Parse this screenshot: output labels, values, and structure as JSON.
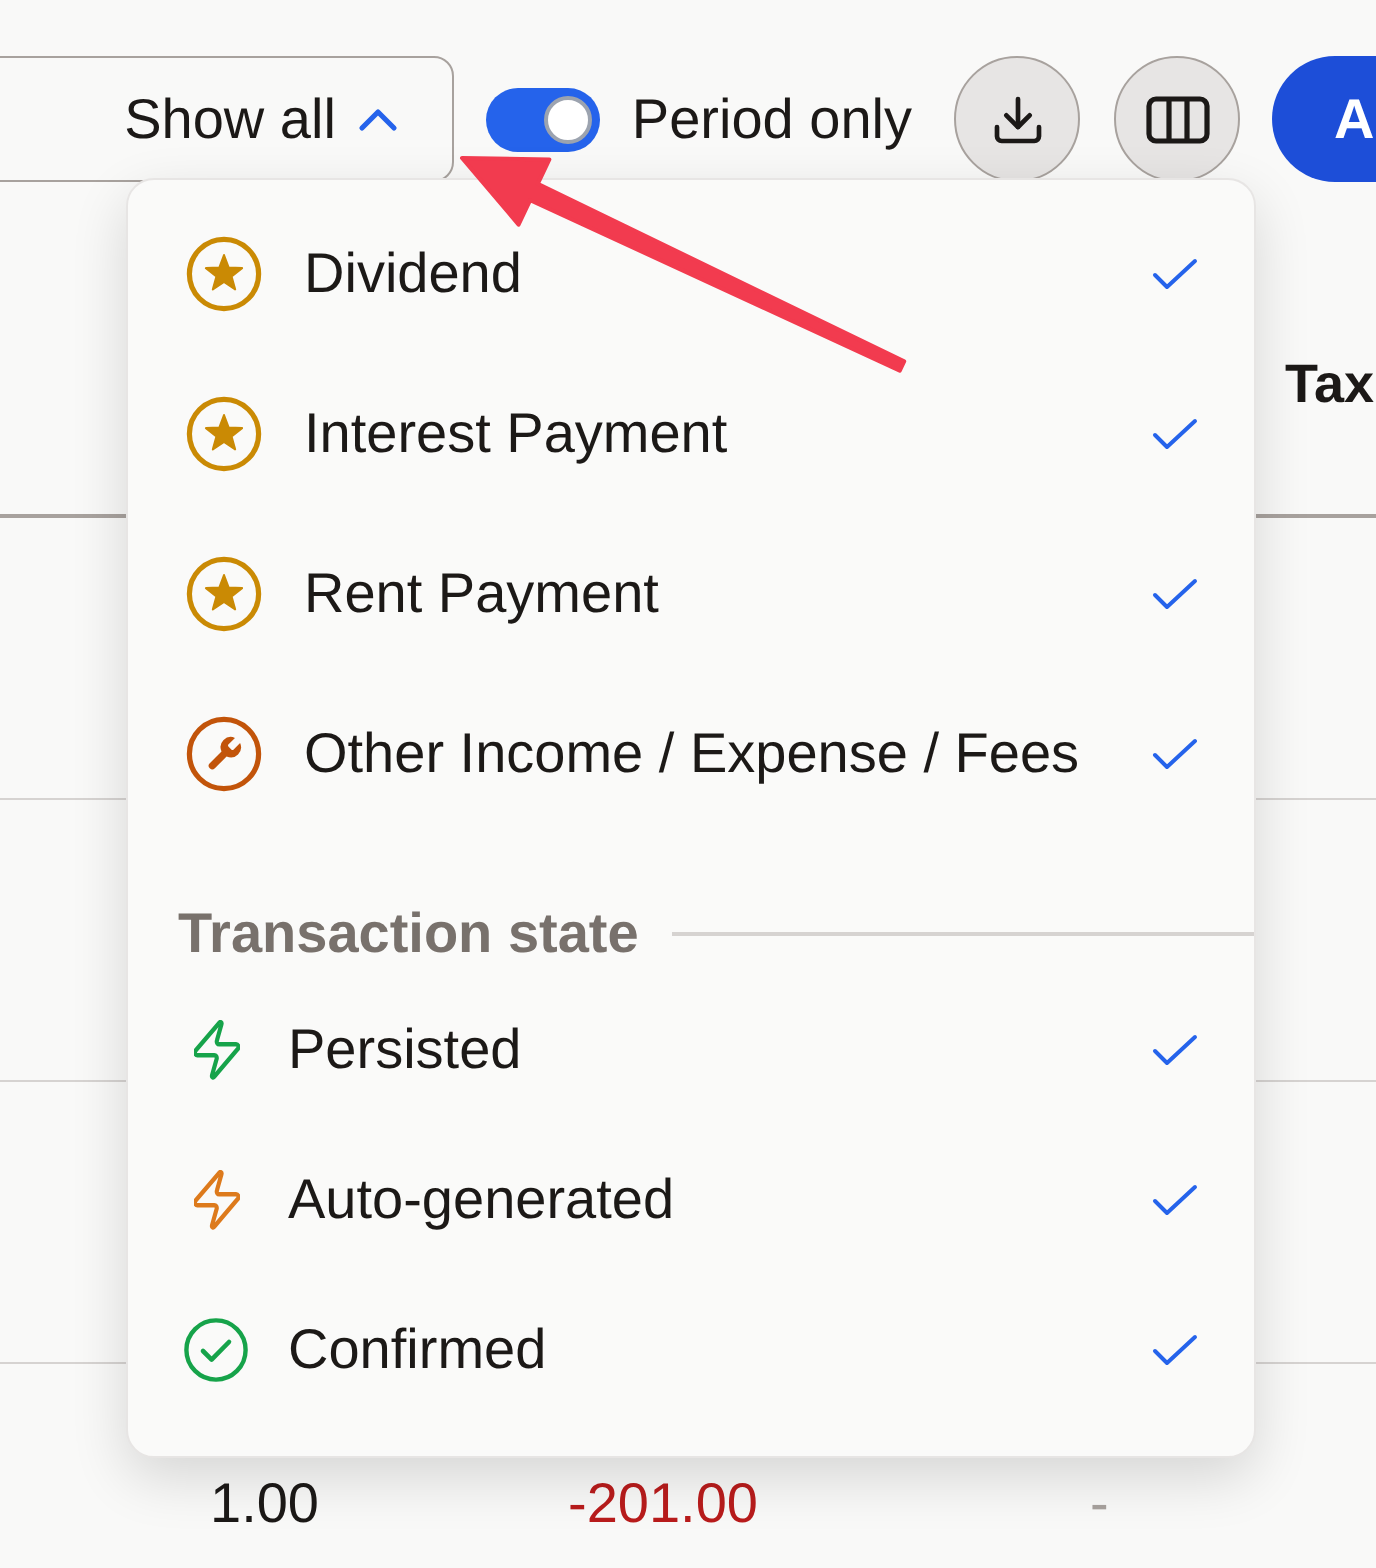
{
  "toolbar": {
    "filter_select": {
      "value": "Show all",
      "expanded": true
    },
    "period_toggle": {
      "label": "Period only",
      "on": true
    },
    "primary_button": {
      "label": "A"
    }
  },
  "table": {
    "header": "Tax",
    "rows": [
      {
        "cells": [
          {
            "text": "1.00",
            "kind": "plain"
          },
          {
            "text": "-201.00",
            "kind": "negative"
          },
          {
            "text": "-",
            "kind": "empty"
          }
        ]
      }
    ]
  },
  "filter_menu": {
    "groups": [
      {
        "items": [
          {
            "label": "Dividend",
            "kind": "income",
            "color": "#ca8a04",
            "checked": true
          },
          {
            "label": "Interest Payment",
            "kind": "income",
            "color": "#ca8a04",
            "checked": true
          },
          {
            "label": "Rent Payment",
            "kind": "income",
            "color": "#ca8a04",
            "checked": true
          },
          {
            "label": "Other Income / Expense / Fees",
            "kind": "other",
            "color": "#c2540a",
            "checked": true
          }
        ]
      },
      {
        "title": "Transaction state",
        "items": [
          {
            "label": "Persisted",
            "kind": "unconfirmed",
            "color": "#16a34a",
            "checked": true
          },
          {
            "label": "Auto-generated",
            "kind": "unconfirmed",
            "color": "#dd7a1c",
            "checked": true
          },
          {
            "label": "Confirmed",
            "kind": "confirmed",
            "color": "#16a34a",
            "checked": true
          }
        ]
      }
    ]
  }
}
